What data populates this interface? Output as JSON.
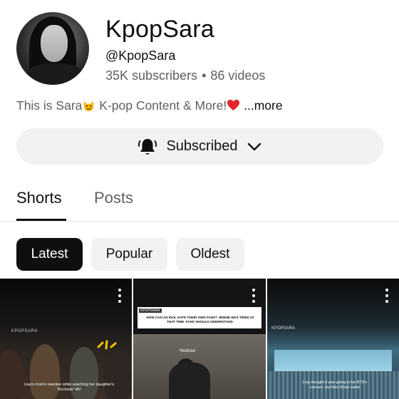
{
  "channel": {
    "name": "KpopSara",
    "handle": "@KpopSara",
    "subscribers": "35K subscribers",
    "separator": "•",
    "videos": "86 videos"
  },
  "description": {
    "text_before": "This is Sara",
    "emoji_1": "cat-face-emoji",
    "text_after": " K-pop Content & More!",
    "emoji_2": "red-heart-emoji",
    "more": " ...more"
  },
  "subscribe_button": {
    "label": "Subscribed",
    "icon": "bell-icon",
    "dropdown_icon": "chevron-down-icon"
  },
  "tabs": [
    {
      "label": "Shorts",
      "active": true
    },
    {
      "label": "Posts",
      "active": false
    }
  ],
  "sort_chips": [
    {
      "label": "Latest",
      "selected": true
    },
    {
      "label": "Popular",
      "selected": false
    },
    {
      "label": "Oldest",
      "selected": false
    }
  ],
  "shorts": [
    {
      "tag": "KPOPSARA",
      "caption": "Lisa's mom's reaction while watching her daughter's 'Rockstar' MV"
    },
    {
      "tag": "KPOPSARA",
      "caption": "HOW CAN AN IDOL HATE THEIR OWN FANS? JENNIE WAS TIRED AT THAT TIME. FANS SHOULD UNDERSTAND.",
      "overlay": "*Noticed"
    },
    {
      "tag": "KPOPSARA",
      "caption": "Lisa thought it was going to be BTS's concert, but then Rosé came"
    }
  ],
  "colors": {
    "text_primary": "#0f0f0f",
    "text_secondary": "#606060",
    "chip_bg": "#f2f2f2",
    "chip_selected_bg": "#0f0f0f",
    "heart": "#e3242b"
  }
}
